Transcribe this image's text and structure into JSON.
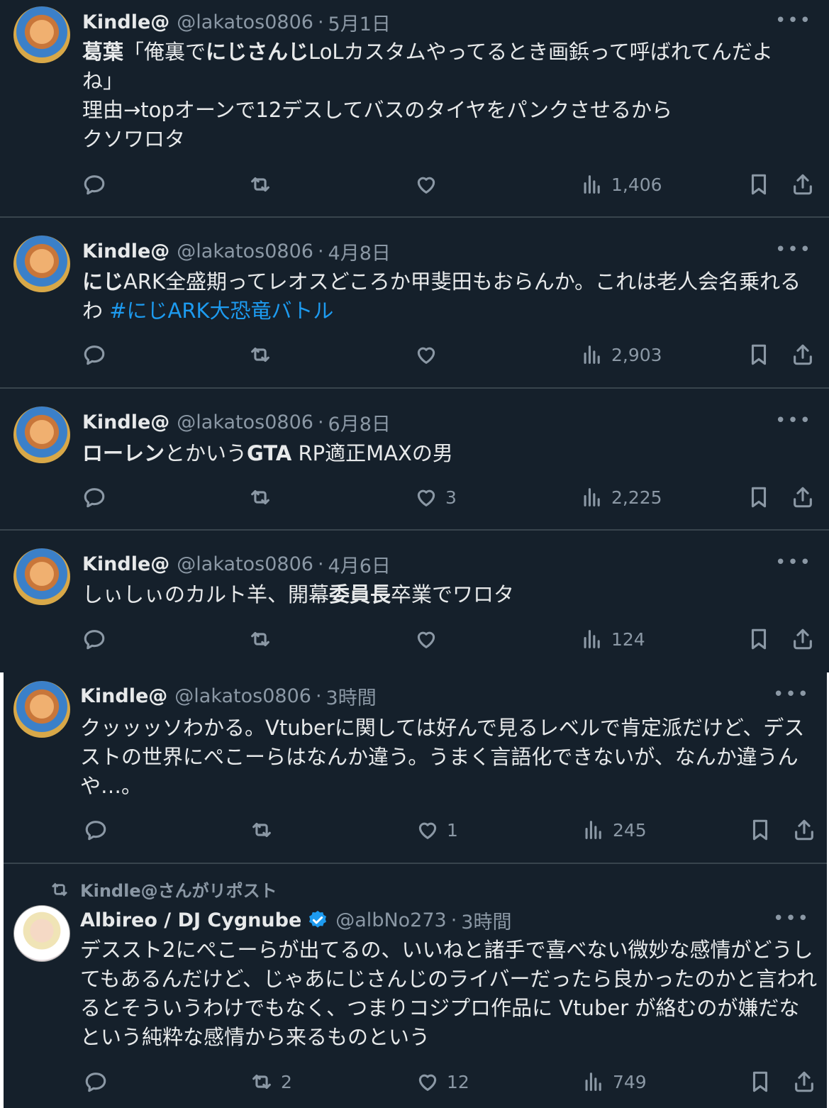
{
  "tweets": [
    {
      "name": "Kindle@",
      "handle": "@lakatos0806",
      "time": "5月1日",
      "body": [
        {
          "b": "葛葉"
        },
        {
          "t": "「俺裏で"
        },
        {
          "b": "にじさんじ"
        },
        {
          "t": "LoLカスタムやってるとき画鋲って呼ばれてんだよね」"
        },
        {
          "br": true
        },
        {
          "t": "理由→topオーンで12デスしてバスのタイヤをパンクさせるから"
        },
        {
          "br": true
        },
        {
          "t": "クソワロタ"
        }
      ],
      "replies": "",
      "reposts": "",
      "likes": "",
      "views": "1,406"
    },
    {
      "name": "Kindle@",
      "handle": "@lakatos0806",
      "time": "4月8日",
      "body": [
        {
          "b": "にじ"
        },
        {
          "t": "ARK全盛期ってレオスどころか甲斐田もおらんか。これは老人会名乗れるわ "
        },
        {
          "tag": "#にじARK大恐竜バトル"
        }
      ],
      "replies": "",
      "reposts": "",
      "likes": "",
      "views": "2,903"
    },
    {
      "name": "Kindle@",
      "handle": "@lakatos0806",
      "time": "6月8日",
      "body": [
        {
          "b": "ローレン"
        },
        {
          "t": "とかいう"
        },
        {
          "b": "GTA"
        },
        {
          "t": " RP適正MAXの男"
        }
      ],
      "replies": "",
      "reposts": "",
      "likes": "3",
      "views": "2,225"
    },
    {
      "name": "Kindle@",
      "handle": "@lakatos0806",
      "time": "4月6日",
      "body": [
        {
          "t": "しぃしぃのカルト羊、開幕"
        },
        {
          "b": "委員長"
        },
        {
          "t": "卒業でワロタ"
        }
      ],
      "replies": "",
      "reposts": "",
      "likes": "",
      "views": "124"
    },
    {
      "name": "Kindle@",
      "handle": "@lakatos0806",
      "time": "3時間",
      "body": [
        {
          "t": "クッッッソわかる。Vtuberに関しては好んで見るレベルで肯定派だけど、デスストの世界にぺこーらはなんか違う。うまく言語化できないが、なんか違うんや…。"
        }
      ],
      "replies": "",
      "reposts": "",
      "likes": "1",
      "views": "245"
    },
    {
      "repost_label": "Kindle@さんがリポスト",
      "name": "Albireo / DJ Cygnube",
      "handle": "@albNo273",
      "time": "3時間",
      "verified": true,
      "body": [
        {
          "t": "デススト2にぺこーらが出てるの、いいねと諸手で喜べない微妙な感情がどうしてもあるんだけど、じゃあにじさんじのライバーだったら良かったのかと言われるとそういうわけでもなく、つまりコジプロ作品に Vtuber が絡むのが嫌だなという純粋な感情から来るものという"
        }
      ],
      "replies": "",
      "reposts": "2",
      "likes": "12",
      "views": "749"
    }
  ],
  "more_label": "•••",
  "colors": {
    "bg": "#15202b",
    "text": "#e7e9ea",
    "muted": "#8b98a5",
    "link": "#1d9bf0",
    "divider": "#38444d"
  }
}
